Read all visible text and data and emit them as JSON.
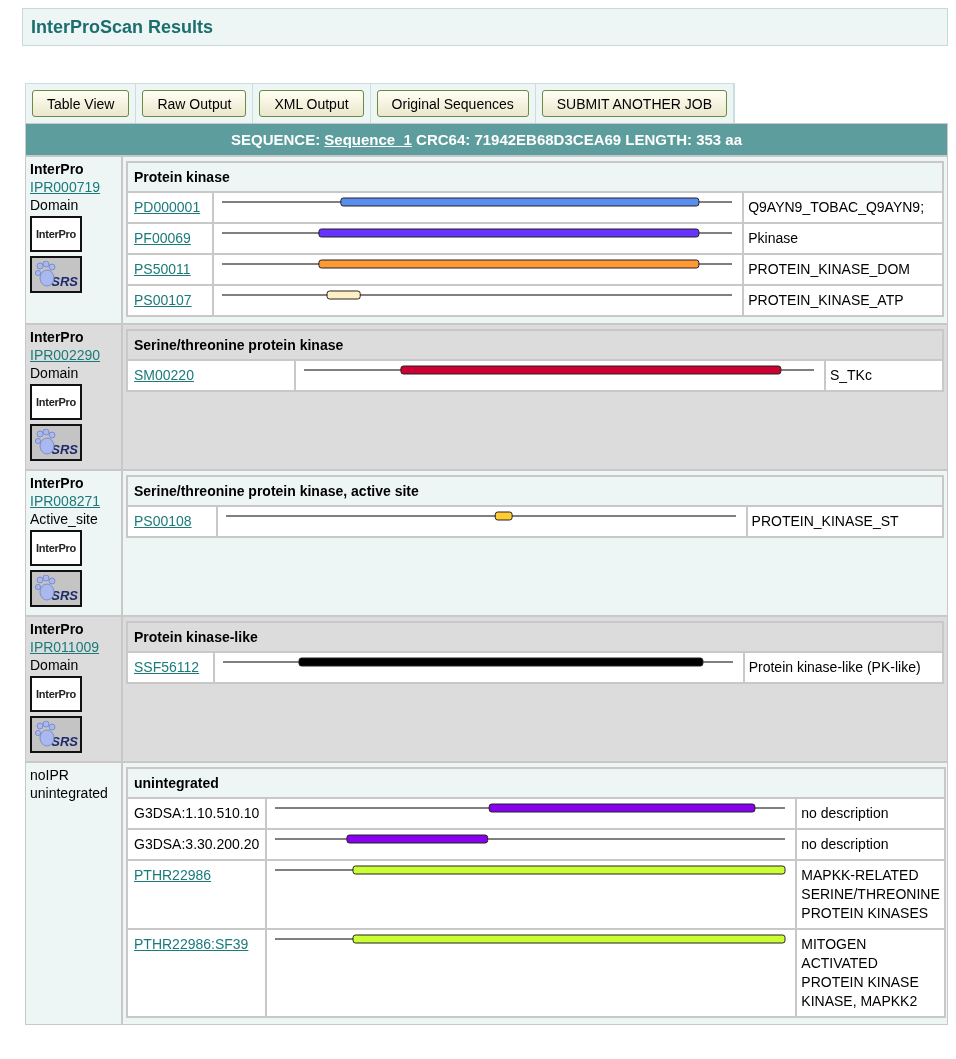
{
  "title": "InterProScan Results",
  "buttons": [
    "Table View",
    "Raw Output",
    "XML Output",
    "Original Sequences",
    "SUBMIT ANOTHER JOB"
  ],
  "sequence_header": {
    "label": "SEQUENCE:",
    "link": "Sequence_1",
    "details": "CRC64: 71942EB68D3CEA69 LENGTH: 353 aa"
  },
  "entries": [
    {
      "kind": "interpro",
      "source": "InterPro",
      "accession": "IPR000719",
      "type": "Domain",
      "logo_links": [
        "InterPro",
        "SRS"
      ],
      "title": "Protein kinase",
      "matches": [
        {
          "name": "PD000001",
          "linked": true,
          "color": "#5b8def",
          "description": "Q9AYN9_TOBAC_Q9AYN9;"
        },
        {
          "name": "PF00069",
          "linked": true,
          "color": "#6633ff",
          "description": "Pkinase"
        },
        {
          "name": "PS50011",
          "linked": true,
          "color": "#ff9933",
          "description": "PROTEIN_KINASE_DOM"
        },
        {
          "name": "PS00107",
          "linked": true,
          "color": "#fff0c4",
          "description": "PROTEIN_KINASE_ATP"
        }
      ]
    },
    {
      "kind": "interpro",
      "source": "InterPro",
      "accession": "IPR002290",
      "type": "Domain",
      "logo_links": [
        "InterPro",
        "SRS"
      ],
      "title": "Serine/threonine protein kinase",
      "matches": [
        {
          "name": "SM00220",
          "linked": true,
          "color": "#cc0033",
          "description": "S_TKc"
        }
      ]
    },
    {
      "kind": "interpro",
      "source": "InterPro",
      "accession": "IPR008271",
      "type": "Active_site",
      "logo_links": [
        "InterPro",
        "SRS"
      ],
      "title": "Serine/threonine protein kinase, active site",
      "matches": [
        {
          "name": "PS00108",
          "linked": true,
          "color": "#ffcc33",
          "description": "PROTEIN_KINASE_ST"
        }
      ]
    },
    {
      "kind": "interpro",
      "source": "InterPro",
      "accession": "IPR011009",
      "type": "Domain",
      "logo_links": [
        "InterPro",
        "SRS"
      ],
      "title": "Protein kinase-like",
      "matches": [
        {
          "name": "SSF56112",
          "linked": true,
          "color": "#000000",
          "description": "Protein kinase-like (PK-like)"
        }
      ]
    },
    {
      "kind": "unintegrated",
      "source": "noIPR",
      "type": "unintegrated",
      "title": "unintegrated",
      "matches": [
        {
          "name": "G3DSA:1.10.510.10",
          "linked": false,
          "color": "#8800ee",
          "description": "no description"
        },
        {
          "name": "G3DSA:3.30.200.20",
          "linked": false,
          "color": "#8800ee",
          "description": "no description"
        },
        {
          "name": "PTHR22986",
          "linked": true,
          "color": "#ccff33",
          "description": "MAPKK-RELATED SERINE/THREONINE PROTEIN KINASES"
        },
        {
          "name": "PTHR22986:SF39",
          "linked": true,
          "color": "#ccff33",
          "description": "MITOGEN ACTIVATED PROTEIN KINASE KINASE, MAPKK2"
        }
      ]
    }
  ]
}
